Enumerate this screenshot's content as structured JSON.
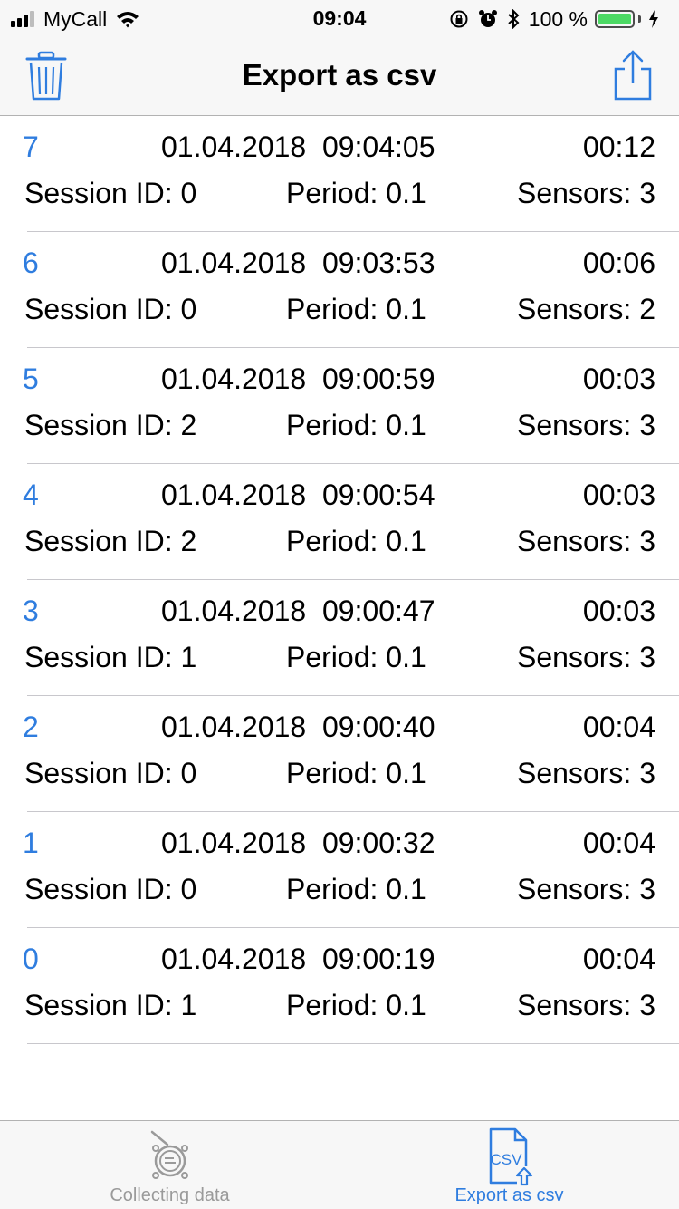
{
  "status_bar": {
    "carrier": "MyCall",
    "time": "09:04",
    "battery_percent": "100 %",
    "battery_level": 1.0,
    "signal_bars_filled": 3,
    "signal_bars_total": 4
  },
  "nav": {
    "title": "Export as csv",
    "left_icon": "trash-icon",
    "right_icon": "share-icon",
    "accent_color": "#2f7ddf"
  },
  "rows": [
    {
      "index": "7",
      "datetime": "01.04.2018  09:04:05",
      "duration": "00:12",
      "session": "Session ID: 0",
      "period": "Period: 0.1",
      "sensors": "Sensors: 3"
    },
    {
      "index": "6",
      "datetime": "01.04.2018  09:03:53",
      "duration": "00:06",
      "session": "Session ID: 0",
      "period": "Period: 0.1",
      "sensors": "Sensors: 2"
    },
    {
      "index": "5",
      "datetime": "01.04.2018  09:00:59",
      "duration": "00:03",
      "session": "Session ID: 2",
      "period": "Period: 0.1",
      "sensors": "Sensors: 3"
    },
    {
      "index": "4",
      "datetime": "01.04.2018  09:00:54",
      "duration": "00:03",
      "session": "Session ID: 2",
      "period": "Period: 0.1",
      "sensors": "Sensors: 3"
    },
    {
      "index": "3",
      "datetime": "01.04.2018  09:00:47",
      "duration": "00:03",
      "session": "Session ID: 1",
      "period": "Period: 0.1",
      "sensors": "Sensors: 3"
    },
    {
      "index": "2",
      "datetime": "01.04.2018  09:00:40",
      "duration": "00:04",
      "session": "Session ID: 0",
      "period": "Period: 0.1",
      "sensors": "Sensors: 3"
    },
    {
      "index": "1",
      "datetime": "01.04.2018  09:00:32",
      "duration": "00:04",
      "session": "Session ID: 0",
      "period": "Period: 0.1",
      "sensors": "Sensors: 3"
    },
    {
      "index": "0",
      "datetime": "01.04.2018  09:00:19",
      "duration": "00:04",
      "session": "Session ID: 1",
      "period": "Period: 0.1",
      "sensors": "Sensors: 3"
    }
  ],
  "tab_bar": {
    "tabs": [
      {
        "label": "Collecting data",
        "icon": "robot-icon",
        "selected": false
      },
      {
        "label": "Export as csv",
        "icon": "csv-file-icon",
        "icon_text": "CSV",
        "selected": true
      }
    ]
  }
}
